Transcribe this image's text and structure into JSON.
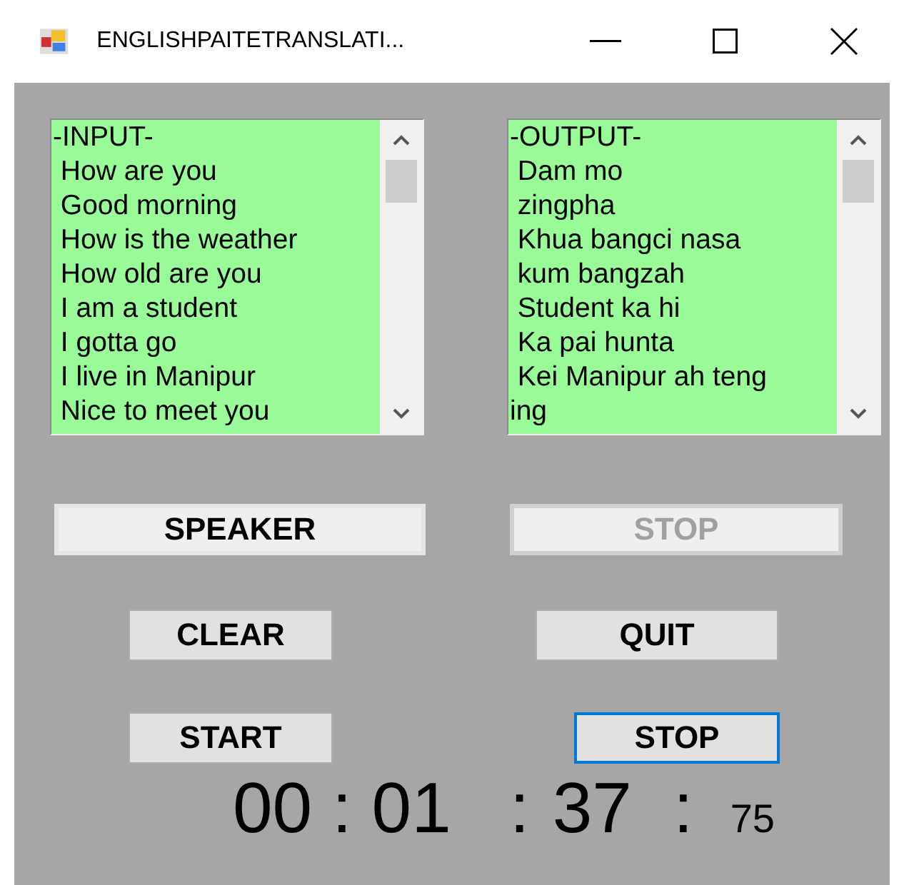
{
  "window": {
    "title": "ENGLISHPAITETRANSLATI..."
  },
  "input_box": {
    "lines": [
      "-INPUT-",
      " How are you",
      " Good morning",
      " How is the weather",
      " How old are you",
      " I am a student",
      " I gotta go",
      " I live in Manipur",
      " Nice to meet you"
    ]
  },
  "output_box": {
    "lines": [
      "-OUTPUT-",
      " Dam mo",
      " zingpha",
      " Khua bangci nasa",
      " kum bangzah",
      " Student ka hi",
      " Ka pai hunta",
      " Kei Manipur ah teng",
      "ing"
    ]
  },
  "buttons": [
    {
      "label": "SPEAKER",
      "disabled": false,
      "focused": false,
      "kind": "wide"
    },
    {
      "label": "STOP",
      "disabled": true,
      "focused": false,
      "kind": "wide"
    },
    {
      "label": "CLEAR",
      "disabled": false,
      "focused": false,
      "kind": "small"
    },
    {
      "label": "QUIT",
      "disabled": false,
      "focused": false,
      "kind": "small"
    },
    {
      "label": "START",
      "disabled": false,
      "focused": false,
      "kind": "small"
    },
    {
      "label": "STOP",
      "disabled": false,
      "focused": true,
      "kind": "small"
    }
  ],
  "timer": [
    {
      "text": "00 : 01",
      "kind": "large"
    },
    {
      "text": ":",
      "kind": "large"
    },
    {
      "text": "37",
      "kind": "large"
    },
    {
      "text": ":",
      "kind": "large"
    },
    {
      "text": "75",
      "kind": "small"
    }
  ]
}
